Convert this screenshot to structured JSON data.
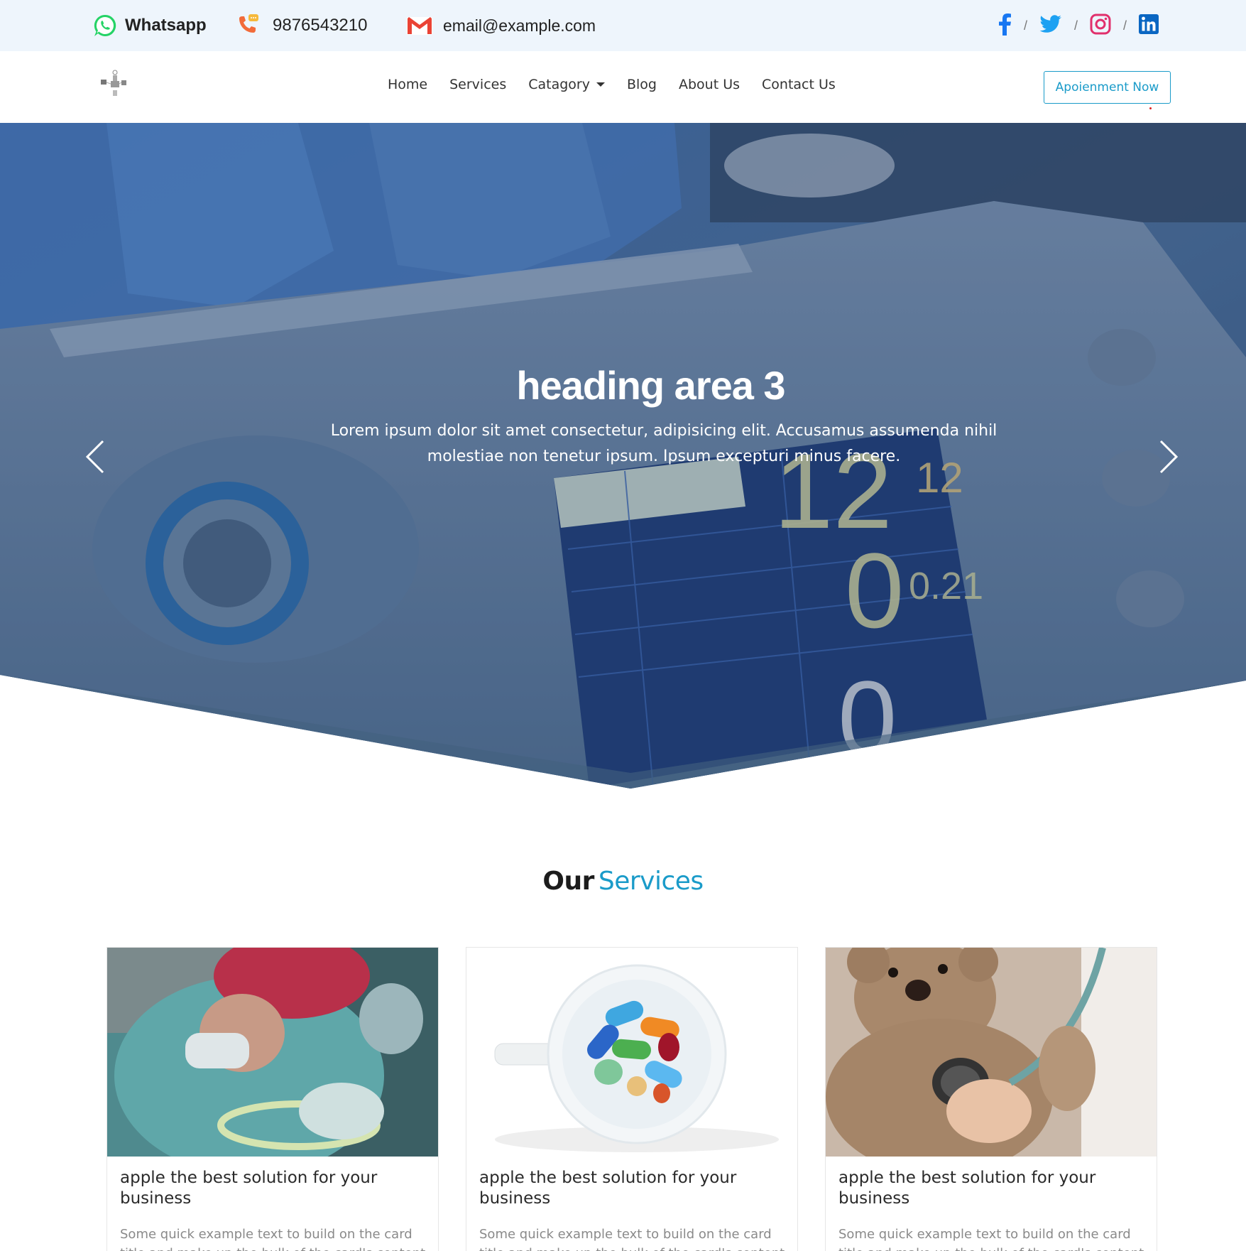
{
  "topbar": {
    "whatsapp_label": "Whatsapp",
    "phone": "9876543210",
    "email": "email@example.com",
    "social_separator": "/",
    "social_icons": [
      "facebook-icon",
      "twitter-icon",
      "instagram-icon",
      "linkedin-icon"
    ]
  },
  "navbar": {
    "links": [
      "Home",
      "Services",
      "Catagory",
      "Blog",
      "About Us",
      "Contact Us"
    ],
    "cta": "Apoienment Now"
  },
  "hero": {
    "title": "heading area 3",
    "text": "Lorem ipsum dolor sit amet consectetur, adipisicing elit. Accusamus assumenda nihil molestiae non tenetur ipsum. Ipsum excepturi minus facere."
  },
  "services": {
    "title_dark": "Our",
    "title_accent": "Services",
    "cards": [
      {
        "title": "apple the best solution for your business",
        "text": "Some quick example text to build on the card title and make up the bulk of the card's content."
      },
      {
        "title": "apple the best solution for your business",
        "text": "Some quick example text to build on the card title and make up the bulk of the card's content."
      },
      {
        "title": "apple the best solution for your business",
        "text": "Some quick example text to build on the card title and make up the bulk of the card's content."
      }
    ]
  },
  "colors": {
    "accent": "#1a9bc9",
    "topbar_bg": "#eef5fc",
    "whatsapp": "#25d366",
    "facebook": "#1877f2",
    "twitter": "#1da1f2",
    "instagram": "#e1306c",
    "linkedin": "#0a66c2"
  }
}
